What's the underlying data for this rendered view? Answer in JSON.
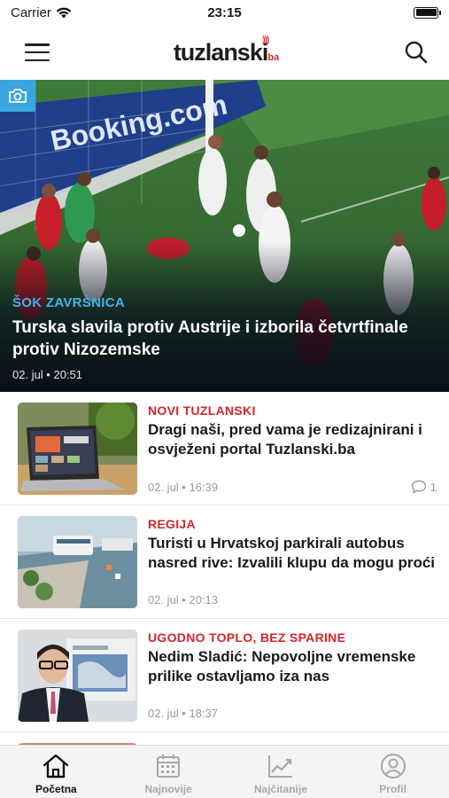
{
  "status_bar": {
    "carrier": "Carrier",
    "time": "23:15"
  },
  "header": {
    "logo_text": "tuzlanski",
    "logo_tld": "ba"
  },
  "hero": {
    "category": "ŠOK ZAVRŠNICA",
    "title": "Turska slavila protiv Austrije i izborila četvrtfinale protiv Nizozemske",
    "time": "02. jul • 20:51",
    "category_color": "#3fb3f0",
    "banner_text": "Booking.com"
  },
  "articles": [
    {
      "category": "NOVI TUZLANSKI",
      "title": "Dragi naši, pred vama je redizajnirani i osvježeni portal Tuzlanski.ba",
      "time": "02. jul • 16:39",
      "comments": "1"
    },
    {
      "category": "REGIJA",
      "title": "Turisti u Hrvatskoj parkirali autobus nasred rive: Izvalili klupu da mogu proći",
      "time": "02. jul • 20:13",
      "comments": ""
    },
    {
      "category": "UGODNO TOPLO, BEZ SPARINE",
      "title": "Nedim Sladić: Nepovoljne vremenske prilike ostavljamo iza nas",
      "time": "02. jul • 18:37",
      "comments": ""
    }
  ],
  "tabs": [
    {
      "label": "Početna",
      "icon": "home-icon",
      "active": true
    },
    {
      "label": "Najnovije",
      "icon": "calendar-icon",
      "active": false
    },
    {
      "label": "Najčitanije",
      "icon": "trending-chart-icon",
      "active": false
    },
    {
      "label": "Profil",
      "icon": "profile-icon",
      "active": false
    }
  ],
  "colors": {
    "accent_red": "#d6252b",
    "accent_blue": "#3fb3f0",
    "camera_badge": "#3aa6e0"
  }
}
